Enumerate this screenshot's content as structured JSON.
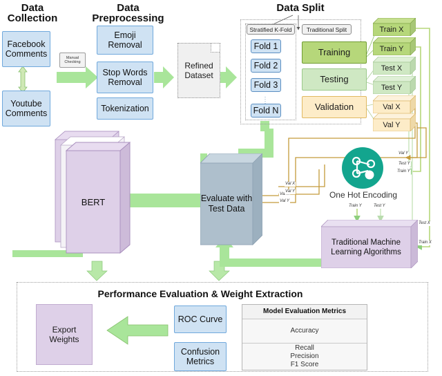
{
  "headings": {
    "data_collection": "Data\nCollection",
    "data_collection_l1": "Data",
    "data_collection_l2": "Collection",
    "data_preprocessing_l1": "Data",
    "data_preprocessing_l2": "Preprocessing",
    "data_split": "Data Split",
    "performance": "Performance Evaluation & Weight Extraction"
  },
  "collection": {
    "facebook": "Facebook\nComments",
    "facebook_l1": "Facebook",
    "facebook_l2": "Comments",
    "youtube_l1": "Youtube",
    "youtube_l2": "Comments",
    "manual_check_l1": "Manual",
    "manual_check_l2": "Checking"
  },
  "preprocessing": {
    "emoji_l1": "Emoji",
    "emoji_l2": "Removal",
    "stopwords_l1": "Stop Words",
    "stopwords_l2": "Removal",
    "tokenization": "Tokenization",
    "refined_l1": "Refined",
    "refined_l2": "Dataset"
  },
  "split": {
    "kfold_label": "Stratified K-Fold",
    "folds": [
      "Fold 1",
      "Fold 2",
      "Fold 3",
      "Fold N"
    ],
    "traditional_label": "Traditional Split",
    "training": "Training",
    "testing": "Testing",
    "validation": "Validation",
    "outputs": [
      "Train X",
      "Train Y",
      "Test X",
      "Test Y",
      "Val X",
      "Val Y"
    ]
  },
  "models": {
    "bert": "BERT",
    "evaluate_l1": "Evaluate with",
    "evaluate_l2": "Test Data",
    "one_hot": "One Hot Encoding",
    "traditional_l1": "Traditional Machine",
    "traditional_l2": "Learning Algorithms"
  },
  "edge_labels": {
    "eval_val_x": "Val X",
    "eval_val_y": "Val Y",
    "ohe_in_val_y": "Val Y",
    "ohe_in_test_y": "Test Y",
    "ohe_in_train_y": "Train Y",
    "ohe_out_train_y": "Train Y",
    "ohe_out_test_y": "Test Y",
    "tml_test_x": "Test X",
    "tml_train_x": "Train X",
    "left_val_x": "Val X",
    "left_val_y": "Val Y"
  },
  "performance": {
    "export_l1": "Export",
    "export_l2": "Weights",
    "roc": "ROC Curve",
    "confusion_l1": "Confusion",
    "confusion_l2": "Metrics",
    "metrics_header": "Model Evaluation Metrics",
    "metrics_rows": [
      "Accuracy",
      "Recall\nPrecision\nF1 Score"
    ],
    "metric_accuracy": "Accuracy",
    "metric_recall": "Recall",
    "metric_precision": "Precision",
    "metric_f1": "F1 Score"
  },
  "colors": {
    "blue_fill": "#cfe2f3",
    "blue_stroke": "#6fa8dc",
    "green_arrow": "#a9e59a",
    "green_arrow_stroke": "#7bbf6a",
    "train_green": "#b6d77a",
    "test_green": "#cfe8c3",
    "val_tan": "#fdecc8",
    "purple": "#ded0e8",
    "slate": "#aebfcc",
    "teal": "#13a58e",
    "gold_line": "#c49a3a"
  }
}
